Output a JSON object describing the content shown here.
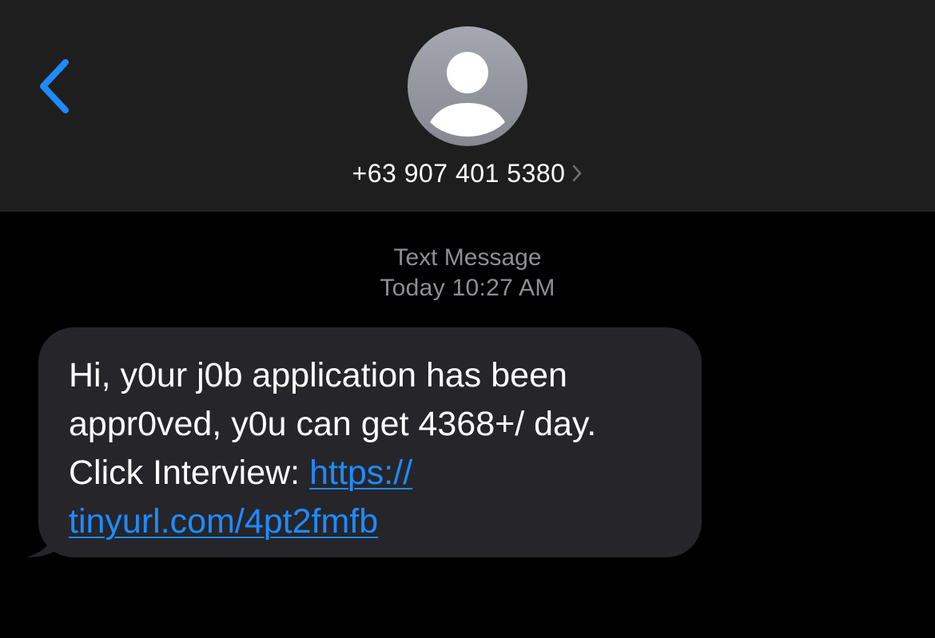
{
  "header": {
    "back_icon": "chevron-left-icon",
    "avatar_icon": "person-silhouette-icon",
    "contact_number": "+63 907 401 5380",
    "contact_chevron_icon": "chevron-right-icon"
  },
  "conversation": {
    "service_label": "Text Message",
    "timestamp": "Today 10:27 AM",
    "messages": [
      {
        "direction": "incoming",
        "text_before_link": "Hi, y0ur j0b application has been appr0ved, y0u can get 4368+/ day. Click Interview:  ",
        "link_line1": "https://",
        "link_line2": "tinyurl.com/4pt2fmfb"
      }
    ]
  },
  "colors": {
    "header_bg": "#1e1e1e",
    "screen_bg": "#000000",
    "bubble_bg": "#26252a",
    "accent": "#1e8bff",
    "secondary_text": "#8e8e93"
  }
}
